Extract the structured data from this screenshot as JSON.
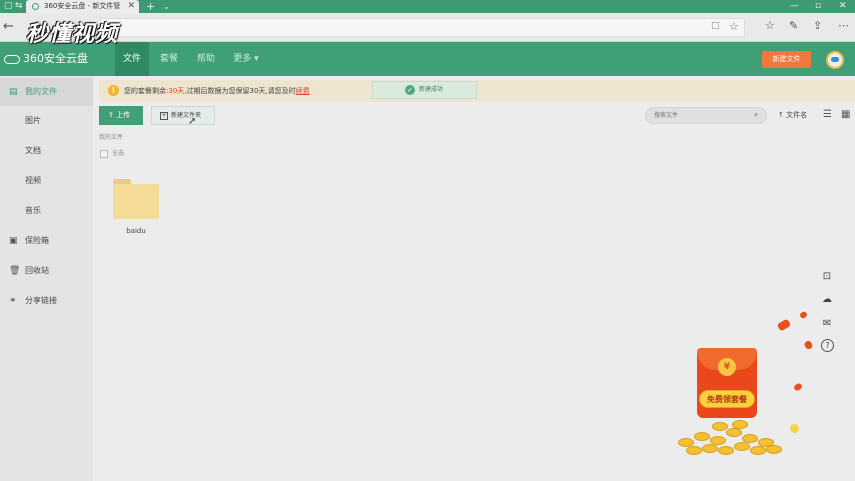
{
  "browser": {
    "tab_title": "360安全云盘 - 新文件管",
    "tab_close": "✕",
    "new_tab": "+",
    "tab_menu": "⌄",
    "window_controls": [
      "—",
      "▫",
      "✕"
    ],
    "back": "←",
    "reader_icon": "□",
    "star_icon": "☆",
    "toolbar_icons": [
      "☆",
      "✎",
      "⇪",
      "⋯"
    ]
  },
  "watermark": "秒懂视频",
  "header": {
    "brand": "360安全云盘",
    "nav": [
      "文件",
      "套餐",
      "帮助",
      "更多 ▾"
    ],
    "new_file_button": "新建文件"
  },
  "sidebar": {
    "items": [
      {
        "icon": "▤",
        "label": "我的文件"
      },
      {
        "icon": "",
        "label": "图片"
      },
      {
        "icon": "",
        "label": "文档"
      },
      {
        "icon": "",
        "label": "视频"
      },
      {
        "icon": "",
        "label": "音乐"
      },
      {
        "icon": "▣",
        "label": "保险箱"
      },
      {
        "icon": "🗑",
        "label": "回收站"
      },
      {
        "icon": "⚭",
        "label": "分享链接"
      }
    ]
  },
  "notice": {
    "icon": "!",
    "prefix": "您的套餐剩余:",
    "days": "30天",
    "middle": ",过期后数据为您保留30天,请您及时",
    "link": "续费"
  },
  "toast": {
    "icon": "✓",
    "text": "新建成功"
  },
  "toolbar": {
    "upload": "⇪ 上传",
    "new_folder_icon": "+",
    "new_folder": "新建文件夹",
    "search_placeholder": "搜索文件",
    "search_icon": "⌕",
    "sort": "↑ 文件名",
    "list_view_icon": "☰",
    "grid_view_icon": "▦"
  },
  "breadcrumb": "我的文件",
  "select_all": "全选",
  "files": [
    {
      "name": "baidu",
      "type": "folder"
    }
  ],
  "right_tools": [
    "⊡",
    "☁",
    "✉",
    "?"
  ],
  "promo": {
    "yen": "¥",
    "label": "免费领套餐"
  }
}
